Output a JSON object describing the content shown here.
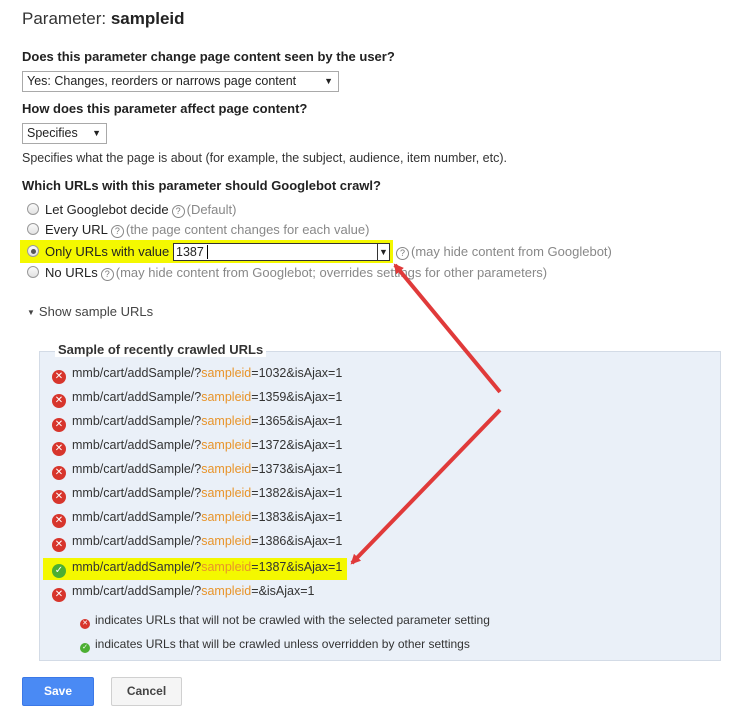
{
  "header": {
    "prefix": "Parameter: ",
    "param_name": "sampleid"
  },
  "question1": {
    "label": "Does this parameter change page content seen by the user?",
    "selected": "Yes: Changes, reorders or narrows page content"
  },
  "question2": {
    "label": "How does this parameter affect page content?",
    "selected": "Specifies",
    "description": "Specifies what the page is about (for example, the subject, audience, item number, etc)."
  },
  "question3": {
    "label": "Which URLs with this parameter should Googlebot crawl?",
    "options": [
      {
        "label": "Let Googlebot decide",
        "hint": "(Default)"
      },
      {
        "label": "Every URL",
        "hint": "(the page content changes for each value)"
      },
      {
        "label": "Only URLs with value",
        "value": "1387",
        "hint": "(may hide content from Googlebot)"
      },
      {
        "label": "No URLs",
        "hint": "(may hide content from Googlebot; overrides settings for other parameters)"
      }
    ],
    "selected_index": 2
  },
  "toggle_label": "Show sample URLs",
  "samples": {
    "title": "Sample of recently crawled URLs",
    "rows": [
      {
        "status": "error",
        "prefix": "mmb/cart/addSample/?",
        "param": "sampleid",
        "suffix": "=1032&isAjax=1"
      },
      {
        "status": "error",
        "prefix": "mmb/cart/addSample/?",
        "param": "sampleid",
        "suffix": "=1359&isAjax=1"
      },
      {
        "status": "error",
        "prefix": "mmb/cart/addSample/?",
        "param": "sampleid",
        "suffix": "=1365&isAjax=1"
      },
      {
        "status": "error",
        "prefix": "mmb/cart/addSample/?",
        "param": "sampleid",
        "suffix": "=1372&isAjax=1"
      },
      {
        "status": "error",
        "prefix": "mmb/cart/addSample/?",
        "param": "sampleid",
        "suffix": "=1373&isAjax=1"
      },
      {
        "status": "error",
        "prefix": "mmb/cart/addSample/?",
        "param": "sampleid",
        "suffix": "=1382&isAjax=1"
      },
      {
        "status": "error",
        "prefix": "mmb/cart/addSample/?",
        "param": "sampleid",
        "suffix": "=1383&isAjax=1"
      },
      {
        "status": "error",
        "prefix": "mmb/cart/addSample/?",
        "param": "sampleid",
        "suffix": "=1386&isAjax=1"
      },
      {
        "status": "ok",
        "prefix": "mmb/cart/addSample/?",
        "param": "sampleid",
        "suffix": "=1387&isAjax=1"
      },
      {
        "status": "error",
        "prefix": "mmb/cart/addSample/?",
        "param": "sampleid",
        "suffix": "=&isAjax=1"
      }
    ],
    "legend": [
      {
        "status": "error",
        "text": "indicates URLs that will not be crawled with the selected parameter setting"
      },
      {
        "status": "ok",
        "text": "indicates URLs that will be crawled unless overridden by other settings"
      }
    ]
  },
  "buttons": {
    "save": "Save",
    "cancel": "Cancel"
  },
  "colors": {
    "highlight": "#f4f800",
    "arrow": "#e03a3a",
    "param": "#e8942a",
    "error": "#d7352c",
    "ok": "#4caf32",
    "primary": "#4a8af4"
  },
  "icons": {
    "error": "x-circle-icon",
    "ok": "check-circle-icon",
    "help": "help-circle-icon",
    "toggle": "caret-down-icon"
  }
}
